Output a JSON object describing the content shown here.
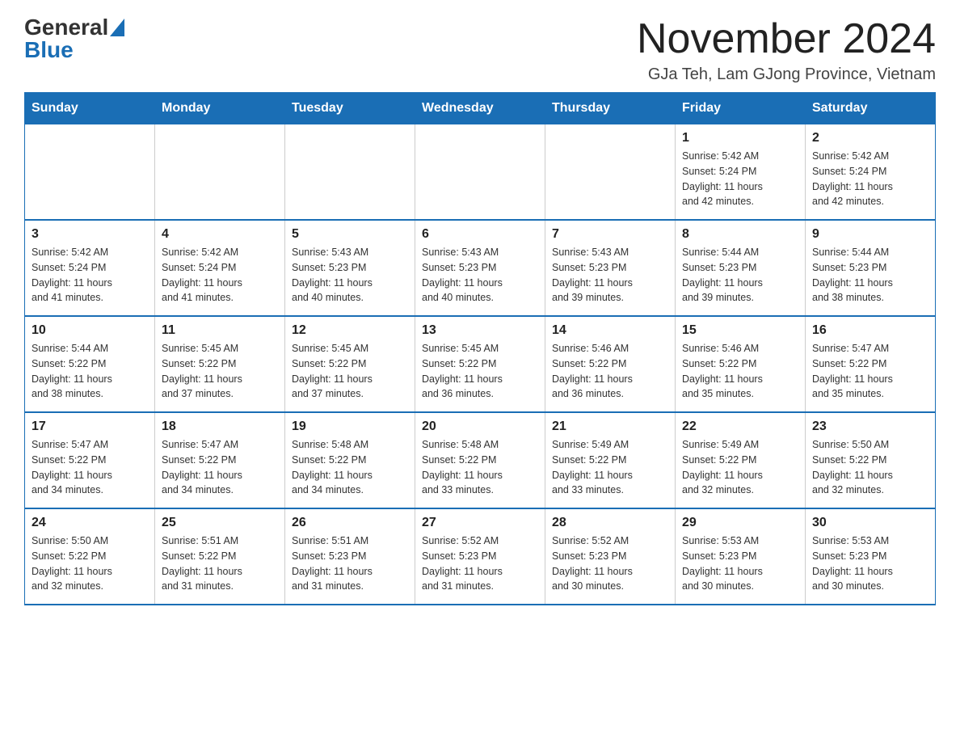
{
  "logo": {
    "general": "General",
    "blue": "Blue"
  },
  "header": {
    "month_title": "November 2024",
    "location": "GJa Teh, Lam GJong Province, Vietnam"
  },
  "weekdays": [
    "Sunday",
    "Monday",
    "Tuesday",
    "Wednesday",
    "Thursday",
    "Friday",
    "Saturday"
  ],
  "weeks": [
    [
      {
        "day": "",
        "info": ""
      },
      {
        "day": "",
        "info": ""
      },
      {
        "day": "",
        "info": ""
      },
      {
        "day": "",
        "info": ""
      },
      {
        "day": "",
        "info": ""
      },
      {
        "day": "1",
        "info": "Sunrise: 5:42 AM\nSunset: 5:24 PM\nDaylight: 11 hours\nand 42 minutes."
      },
      {
        "day": "2",
        "info": "Sunrise: 5:42 AM\nSunset: 5:24 PM\nDaylight: 11 hours\nand 42 minutes."
      }
    ],
    [
      {
        "day": "3",
        "info": "Sunrise: 5:42 AM\nSunset: 5:24 PM\nDaylight: 11 hours\nand 41 minutes."
      },
      {
        "day": "4",
        "info": "Sunrise: 5:42 AM\nSunset: 5:24 PM\nDaylight: 11 hours\nand 41 minutes."
      },
      {
        "day": "5",
        "info": "Sunrise: 5:43 AM\nSunset: 5:23 PM\nDaylight: 11 hours\nand 40 minutes."
      },
      {
        "day": "6",
        "info": "Sunrise: 5:43 AM\nSunset: 5:23 PM\nDaylight: 11 hours\nand 40 minutes."
      },
      {
        "day": "7",
        "info": "Sunrise: 5:43 AM\nSunset: 5:23 PM\nDaylight: 11 hours\nand 39 minutes."
      },
      {
        "day": "8",
        "info": "Sunrise: 5:44 AM\nSunset: 5:23 PM\nDaylight: 11 hours\nand 39 minutes."
      },
      {
        "day": "9",
        "info": "Sunrise: 5:44 AM\nSunset: 5:23 PM\nDaylight: 11 hours\nand 38 minutes."
      }
    ],
    [
      {
        "day": "10",
        "info": "Sunrise: 5:44 AM\nSunset: 5:22 PM\nDaylight: 11 hours\nand 38 minutes."
      },
      {
        "day": "11",
        "info": "Sunrise: 5:45 AM\nSunset: 5:22 PM\nDaylight: 11 hours\nand 37 minutes."
      },
      {
        "day": "12",
        "info": "Sunrise: 5:45 AM\nSunset: 5:22 PM\nDaylight: 11 hours\nand 37 minutes."
      },
      {
        "day": "13",
        "info": "Sunrise: 5:45 AM\nSunset: 5:22 PM\nDaylight: 11 hours\nand 36 minutes."
      },
      {
        "day": "14",
        "info": "Sunrise: 5:46 AM\nSunset: 5:22 PM\nDaylight: 11 hours\nand 36 minutes."
      },
      {
        "day": "15",
        "info": "Sunrise: 5:46 AM\nSunset: 5:22 PM\nDaylight: 11 hours\nand 35 minutes."
      },
      {
        "day": "16",
        "info": "Sunrise: 5:47 AM\nSunset: 5:22 PM\nDaylight: 11 hours\nand 35 minutes."
      }
    ],
    [
      {
        "day": "17",
        "info": "Sunrise: 5:47 AM\nSunset: 5:22 PM\nDaylight: 11 hours\nand 34 minutes."
      },
      {
        "day": "18",
        "info": "Sunrise: 5:47 AM\nSunset: 5:22 PM\nDaylight: 11 hours\nand 34 minutes."
      },
      {
        "day": "19",
        "info": "Sunrise: 5:48 AM\nSunset: 5:22 PM\nDaylight: 11 hours\nand 34 minutes."
      },
      {
        "day": "20",
        "info": "Sunrise: 5:48 AM\nSunset: 5:22 PM\nDaylight: 11 hours\nand 33 minutes."
      },
      {
        "day": "21",
        "info": "Sunrise: 5:49 AM\nSunset: 5:22 PM\nDaylight: 11 hours\nand 33 minutes."
      },
      {
        "day": "22",
        "info": "Sunrise: 5:49 AM\nSunset: 5:22 PM\nDaylight: 11 hours\nand 32 minutes."
      },
      {
        "day": "23",
        "info": "Sunrise: 5:50 AM\nSunset: 5:22 PM\nDaylight: 11 hours\nand 32 minutes."
      }
    ],
    [
      {
        "day": "24",
        "info": "Sunrise: 5:50 AM\nSunset: 5:22 PM\nDaylight: 11 hours\nand 32 minutes."
      },
      {
        "day": "25",
        "info": "Sunrise: 5:51 AM\nSunset: 5:22 PM\nDaylight: 11 hours\nand 31 minutes."
      },
      {
        "day": "26",
        "info": "Sunrise: 5:51 AM\nSunset: 5:23 PM\nDaylight: 11 hours\nand 31 minutes."
      },
      {
        "day": "27",
        "info": "Sunrise: 5:52 AM\nSunset: 5:23 PM\nDaylight: 11 hours\nand 31 minutes."
      },
      {
        "day": "28",
        "info": "Sunrise: 5:52 AM\nSunset: 5:23 PM\nDaylight: 11 hours\nand 30 minutes."
      },
      {
        "day": "29",
        "info": "Sunrise: 5:53 AM\nSunset: 5:23 PM\nDaylight: 11 hours\nand 30 minutes."
      },
      {
        "day": "30",
        "info": "Sunrise: 5:53 AM\nSunset: 5:23 PM\nDaylight: 11 hours\nand 30 minutes."
      }
    ]
  ]
}
